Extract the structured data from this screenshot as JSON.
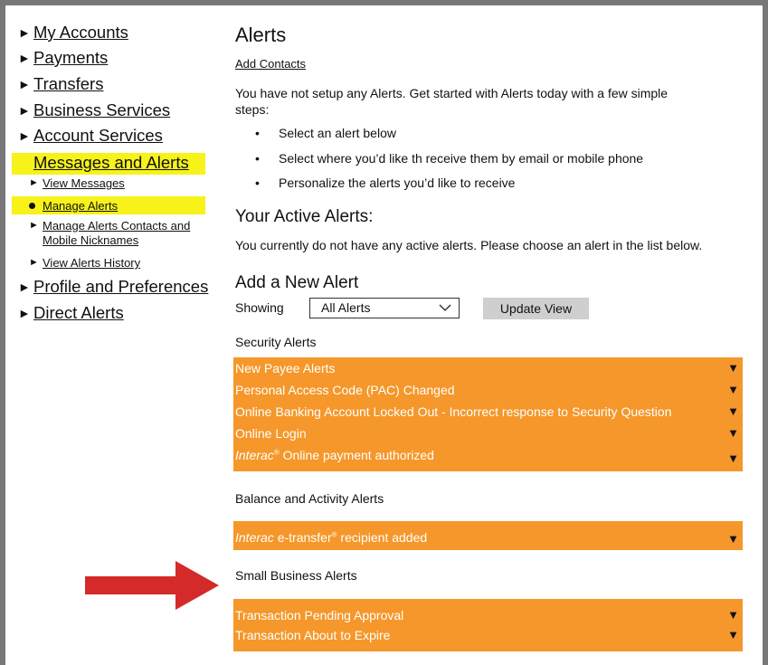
{
  "sidebar": {
    "nav": [
      "My Accounts",
      "Payments",
      "Transfers",
      "Business Services",
      "Account Services"
    ],
    "active_section": "Messages and Alerts",
    "sub_items": [
      "View Messages",
      "Manage Alerts",
      "Manage Alerts Contacts and",
      "Mobile Nicknames",
      "View Alerts History"
    ],
    "after": [
      "Profile and Preferences",
      "Direct Alerts"
    ]
  },
  "main": {
    "title": "Alerts",
    "add_contacts": "Add Contacts",
    "intro_1": "You have not setup any Alerts. Get started with Alerts today with a few simple",
    "intro_2": "steps:",
    "bullets": [
      "Select an alert below",
      "Select where you’d like th receive them by email or mobile phone",
      "Personalize the alerts you’d like to receive"
    ],
    "active_title": "Your Active Alerts:",
    "active_text": "You currently do not have any active alerts. Please choose an alert in the list below.",
    "add_title": "Add a New Alert",
    "showing_label": "Showing",
    "select_value": "All Alerts",
    "update_button": "Update View",
    "security_label": "Security Alerts",
    "security_alerts": [
      "New Payee Alerts",
      "Personal Access Code (PAC) Changed",
      "Online Banking Account Locked Out - Incorrect response to Security Question",
      "Online Login"
    ],
    "interac_online": {
      "italic": "Interac",
      "sup": "®",
      "rest": " Online payment authorized"
    },
    "balance_label": "Balance and Activity Alerts",
    "interac_etransfer": {
      "italic": "Interac",
      "mid": " e-transfer",
      "sup": "®",
      "rest": " recipient added"
    },
    "small_business_label": "Small Business Alerts",
    "small_business_alerts": [
      "Transaction Pending Approval",
      "Transaction About to Expire"
    ],
    "expand_glyph": "▼",
    "nav_glyph": "►"
  },
  "colors": {
    "alert_bar": "#f5972a",
    "highlight": "#f6f21a",
    "annotation_arrow": "#d42a2a"
  }
}
